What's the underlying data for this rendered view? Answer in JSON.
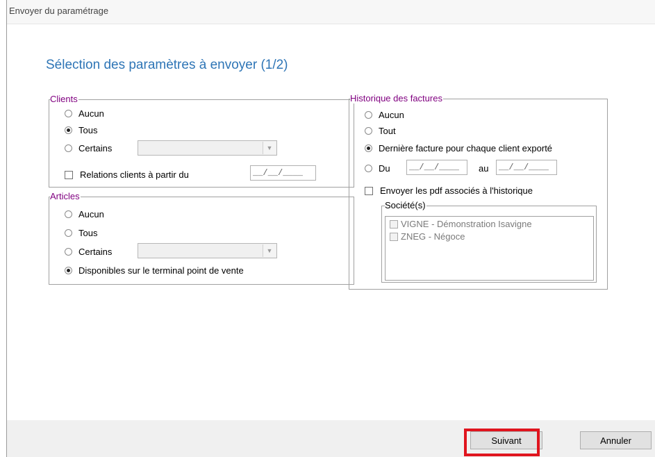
{
  "window": {
    "title": "Envoyer du paramétrage"
  },
  "heading": "Sélection des paramètres à envoyer (1/2)",
  "clients": {
    "legend": "Clients",
    "aucun": "Aucun",
    "tous": "Tous",
    "certains": "Certains",
    "selected": "Tous",
    "relations_label": "Relations clients à partir du",
    "relations_date": "__/__/____",
    "relations_checked": false
  },
  "articles": {
    "legend": "Articles",
    "aucun": "Aucun",
    "tous": "Tous",
    "certains": "Certains",
    "disponibles": "Disponibles sur le terminal point de vente",
    "selected": "Disponibles sur le terminal point de vente"
  },
  "historique": {
    "legend": "Historique des factures",
    "aucun": "Aucun",
    "tout": "Tout",
    "derniere": "Dernière facture pour chaque client exporté",
    "du": "Du",
    "au": "au",
    "date_from": "__/__/____",
    "date_to": "__/__/____",
    "selected": "Dernière facture pour chaque client exporté",
    "pdf_label": "Envoyer les pdf associés à l'historique",
    "pdf_checked": false
  },
  "societes": {
    "legend": "Société(s)",
    "items": [
      {
        "label": "VIGNE - Démonstration Isavigne",
        "checked": false
      },
      {
        "label": "ZNEG - Négoce",
        "checked": false
      }
    ]
  },
  "buttons": {
    "next": "Suivant",
    "cancel": "Annuler"
  },
  "colors": {
    "heading": "#2e75b6",
    "legend": "#800080",
    "highlight": "#e0141e"
  }
}
